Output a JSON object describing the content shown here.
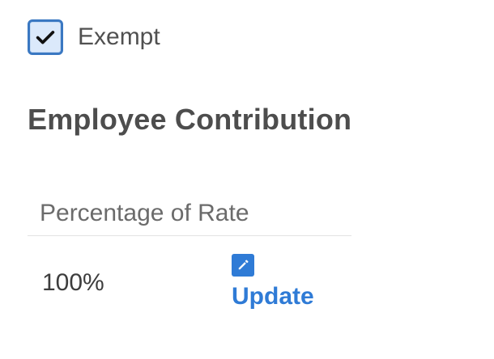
{
  "exempt": {
    "checked": true,
    "label": "Exempt",
    "check_icon": "check-icon"
  },
  "section": {
    "title": "Employee Contribution"
  },
  "table": {
    "header": "Percentage of Rate",
    "rows": [
      {
        "value": "100%",
        "action_label": "Update",
        "action_icon": "pencil-icon"
      }
    ]
  },
  "colors": {
    "accent": "#2f7bd6",
    "checkbox_border": "#3a78c2",
    "checkbox_fill": "#dbe9fb",
    "text": "#4a4a4a"
  }
}
